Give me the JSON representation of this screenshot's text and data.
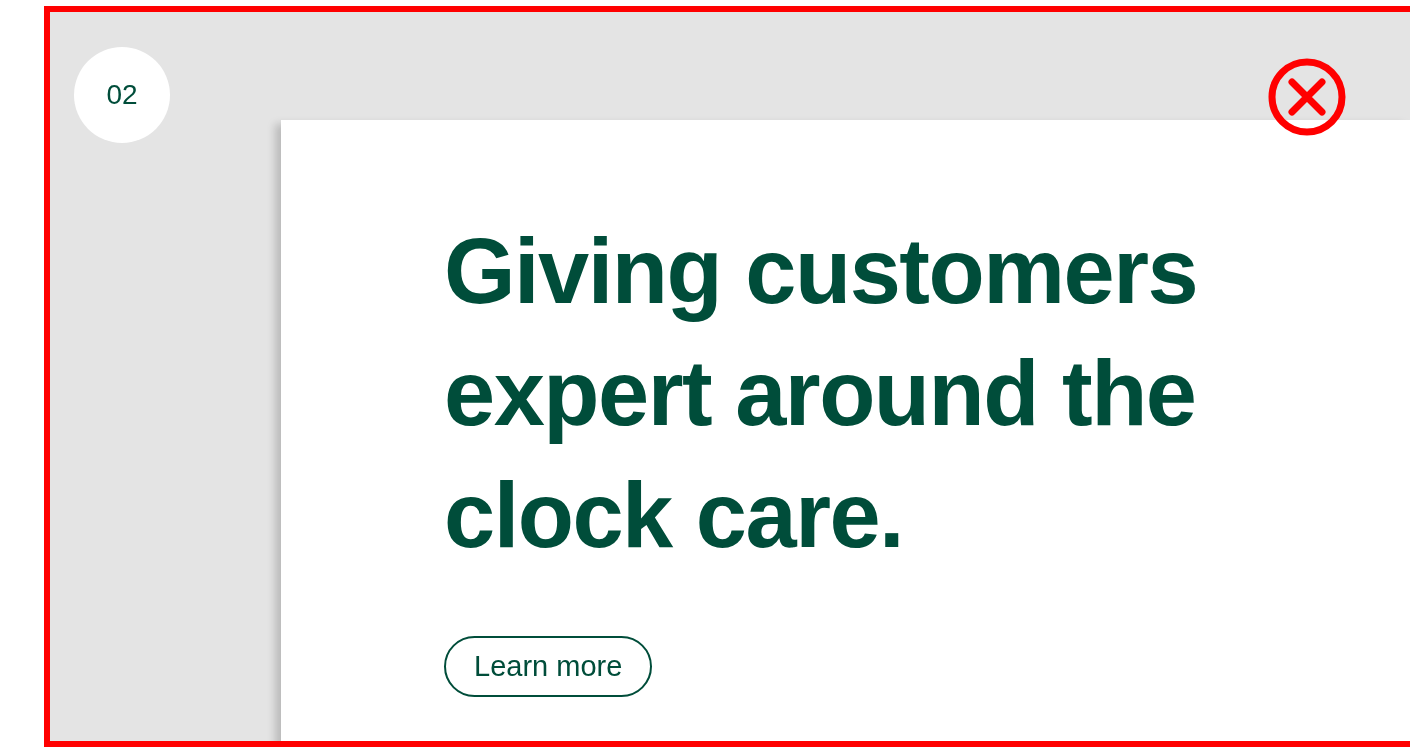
{
  "step_badge": "02",
  "headline": "Giving customers expert around the clock care.",
  "button": {
    "label": "Learn more"
  },
  "marked_wrong": true
}
